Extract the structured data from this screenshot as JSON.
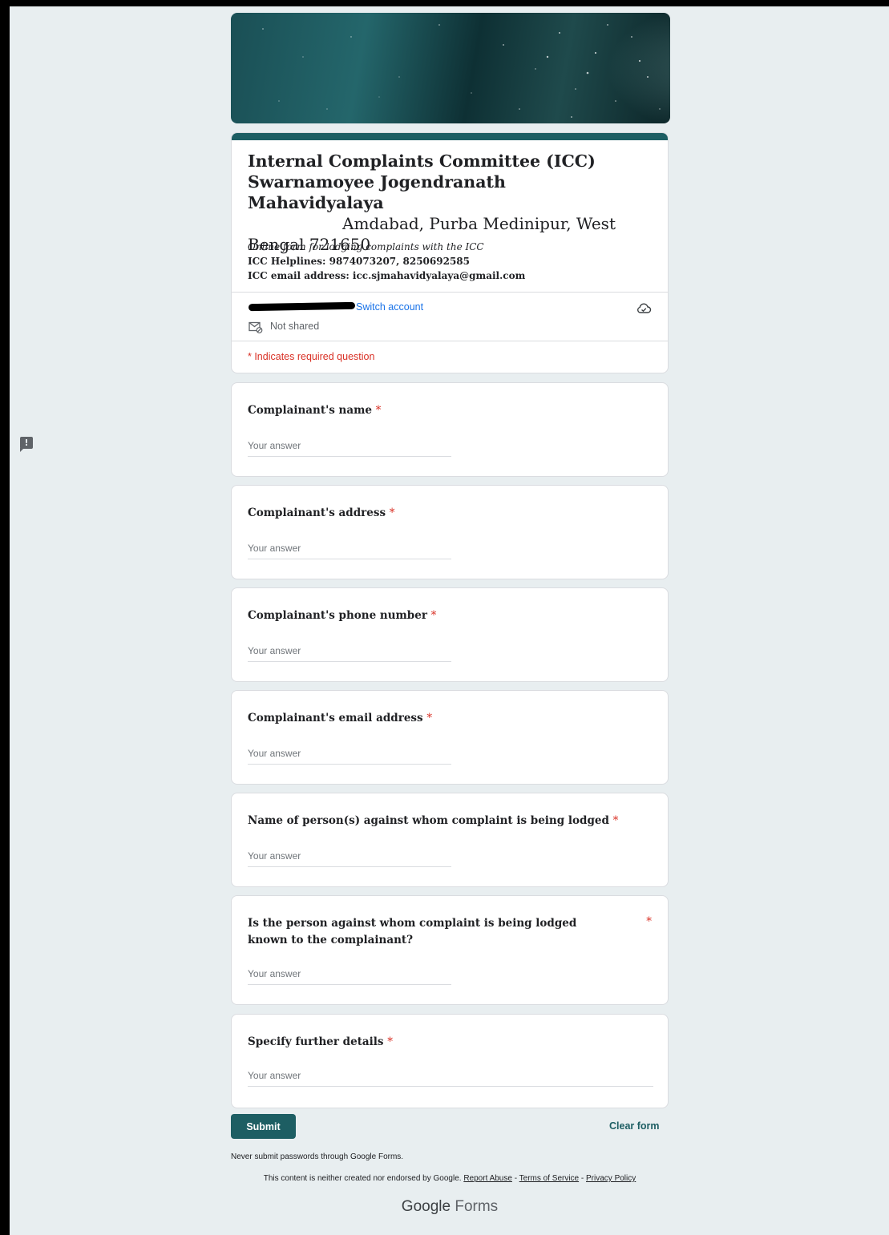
{
  "header": {
    "title_line1": "Internal Complaints Committee (ICC)",
    "title_line2": "Swarnamoyee Jogendranath Mahavidyalaya",
    "title_line3": "Amdabad, Purba Medinipur, West",
    "title_line4": "Bengal 721650",
    "description_italic": "Online form for lodging complaints with the ICC",
    "helplines": "ICC Helplines: 9874073207, 8250692585",
    "email": "ICC email address: icc.sjmahavidyalaya@gmail.com"
  },
  "account": {
    "switch_label": "Switch account",
    "not_shared": "Not shared"
  },
  "required_note": "* Indicates required question",
  "questions": [
    {
      "label": "Complainant's name",
      "required_mark": "*",
      "placeholder": "Your answer"
    },
    {
      "label": "Complainant's address",
      "required_mark": "*",
      "placeholder": "Your answer"
    },
    {
      "label": "Complainant's phone number",
      "required_mark": "*",
      "placeholder": "Your answer"
    },
    {
      "label": "Complainant's email address",
      "required_mark": "*",
      "placeholder": "Your answer"
    },
    {
      "label": "Name of person(s) against whom complaint is being lodged",
      "required_mark": "*",
      "placeholder": "Your answer"
    },
    {
      "label": "Is the person against whom complaint is being lodged known to the complainant?",
      "required_mark": "*",
      "placeholder": "Your answer"
    },
    {
      "label": "Specify further details",
      "required_mark": "*",
      "placeholder": "Your answer"
    }
  ],
  "actions": {
    "submit": "Submit",
    "clear": "Clear form"
  },
  "footer": {
    "never_submit": "Never submit passwords through Google Forms.",
    "disclaimer": "This content is neither created nor endorsed by Google.",
    "report_abuse": "Report Abuse",
    "terms": "Terms of Service",
    "privacy": "Privacy Policy",
    "sep": " - ",
    "brand_google": "Google",
    "brand_forms": "Forms"
  },
  "colors": {
    "theme": "#1d5e63",
    "required": "#d93025",
    "link": "#1a73e8",
    "page_bg": "#e8eef0"
  },
  "icons": [
    "report-icon",
    "cloud-saved-icon",
    "mail-not-shared-icon"
  ]
}
